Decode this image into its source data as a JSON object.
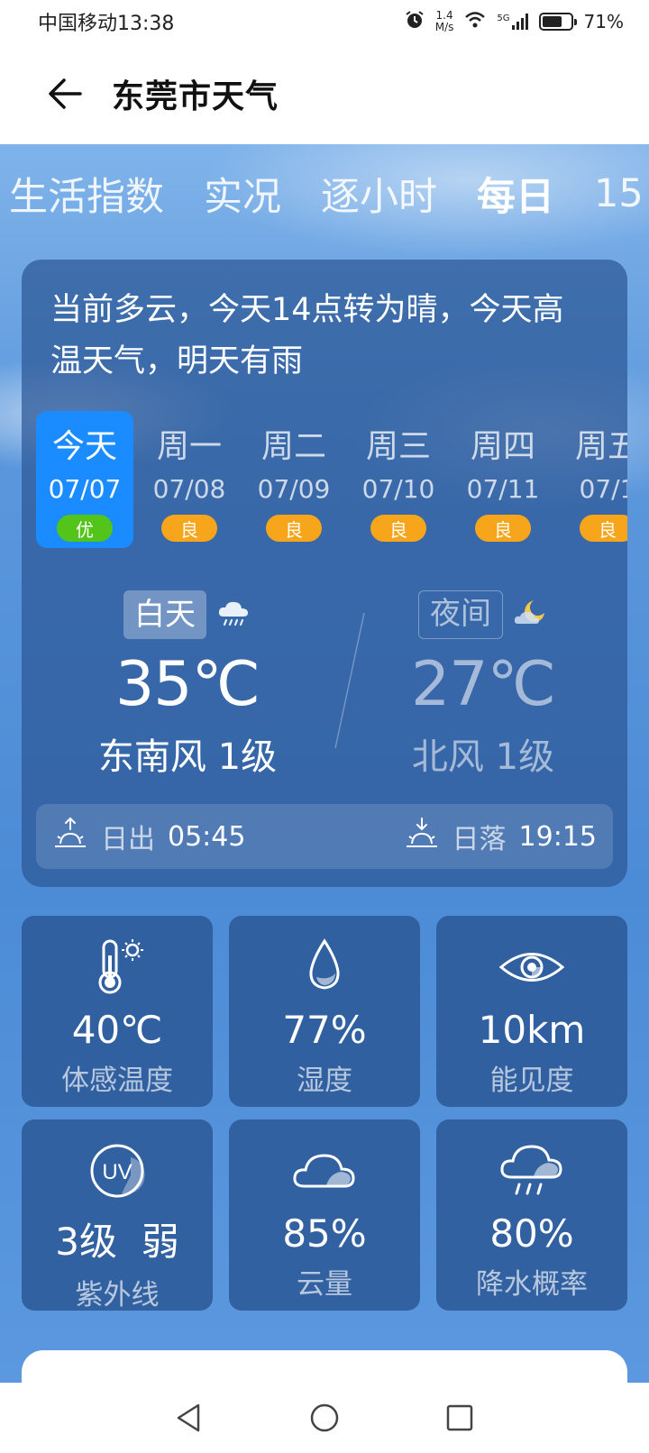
{
  "status_bar": {
    "carrier_time": "中国移动13:38",
    "net_speed_value": "1.4",
    "net_speed_unit": "M/s",
    "network": "5G",
    "battery": "71%",
    "battery_level": 0.71
  },
  "header": {
    "title": "东莞市天气"
  },
  "tabs": [
    {
      "label": "生活指数"
    },
    {
      "label": "实况"
    },
    {
      "label": "逐小时"
    },
    {
      "label": "每日",
      "active": true
    },
    {
      "label": "15"
    }
  ],
  "summary": "当前多云，今天14点转为晴，今天高温天气，明天有雨",
  "days": [
    {
      "name": "今天",
      "date": "07/07",
      "aqi": "优",
      "selected": true
    },
    {
      "name": "周一",
      "date": "07/08",
      "aqi": "良"
    },
    {
      "name": "周二",
      "date": "07/09",
      "aqi": "良"
    },
    {
      "name": "周三",
      "date": "07/10",
      "aqi": "良"
    },
    {
      "name": "周四",
      "date": "07/11",
      "aqi": "良"
    },
    {
      "name": "周五",
      "date": "07/1",
      "aqi": "良"
    }
  ],
  "daytime": {
    "label": "白天",
    "temp": "35℃",
    "wind": "东南风 1级",
    "icon": "rain-cloud-icon"
  },
  "night": {
    "label": "夜间",
    "temp": "27℃",
    "wind": "北风 1级",
    "icon": "moon-cloud-icon"
  },
  "sun": {
    "sunrise_label": "日出",
    "sunrise_time": "05:45",
    "sunset_label": "日落",
    "sunset_time": "19:15"
  },
  "details": [
    {
      "value": "40℃",
      "label": "体感温度",
      "icon": "thermometer-sun-icon"
    },
    {
      "value": "77%",
      "label": "湿度",
      "icon": "water-drop-icon"
    },
    {
      "value": "10km",
      "label": "能见度",
      "icon": "eye-icon"
    },
    {
      "value": "3级  弱",
      "label": "紫外线",
      "icon": "uv-icon"
    },
    {
      "value": "85%",
      "label": "云量",
      "icon": "cloud-icon"
    },
    {
      "value": "80%",
      "label": "降水概率",
      "icon": "rain-icon"
    }
  ],
  "colors": {
    "selected_day": "#1a8cff",
    "aqi_good": "#52c41a",
    "aqi_moderate": "#f7a61b"
  }
}
